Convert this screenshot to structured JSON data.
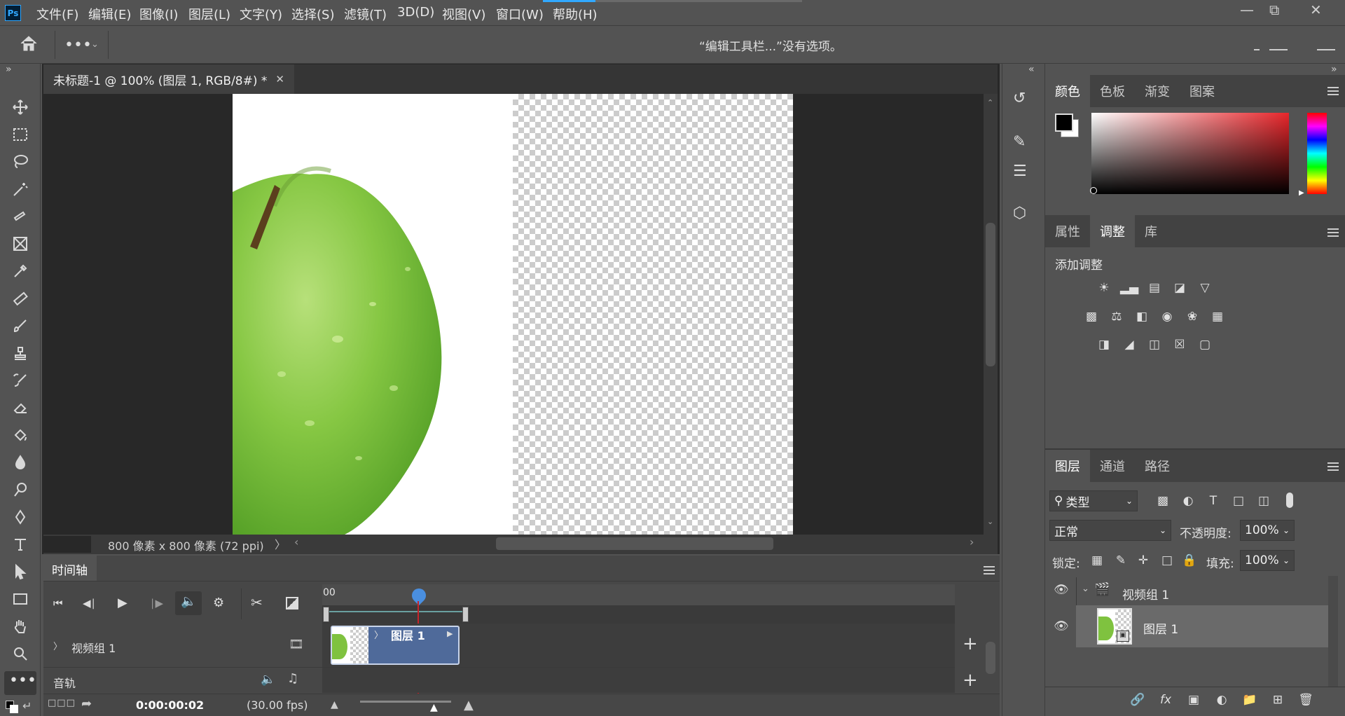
{
  "app": {
    "logo": "Ps"
  },
  "menu": [
    "文件(F)",
    "编辑(E)",
    "图像(I)",
    "图层(L)",
    "文字(Y)",
    "选择(S)",
    "滤镜(T)",
    "3D(D)",
    "视图(V)",
    "窗口(W)",
    "帮助(H)"
  ],
  "options_bar": {
    "message": "“编辑工具栏...”没有选项。"
  },
  "document": {
    "tab_title": "未标题-1 @ 100% (图层 1, RGB/8#) *",
    "status": "800 像素 x 800 像素 (72 ppi)"
  },
  "timeline": {
    "title": "时间轴",
    "ruler_start": "00",
    "track_video_group": "视频组 1",
    "track_audio": "音轨",
    "clip_label": "图层 1",
    "timecode": "0:00:00:02",
    "fps": "(30.00 fps)"
  },
  "color_panel": {
    "tabs": [
      "颜色",
      "色板",
      "渐变",
      "图案"
    ],
    "active": "颜色",
    "foreground": "#000000",
    "background": "#ffffff"
  },
  "adjust_panel": {
    "tabs": [
      "属性",
      "调整",
      "库"
    ],
    "active": "调整",
    "heading": "添加调整"
  },
  "layers_panel": {
    "tabs": [
      "图层",
      "通道",
      "路径"
    ],
    "active": "图层",
    "filter_kind": "类型",
    "blend_mode": "正常",
    "opacity_label": "不透明度:",
    "opacity_value": "100%",
    "lock_label": "锁定:",
    "fill_label": "填充:",
    "fill_value": "100%",
    "layers": [
      {
        "name": "视频组 1",
        "type": "group"
      },
      {
        "name": "图层 1",
        "type": "video-layer"
      }
    ]
  },
  "colors": {
    "ui_bg": "#535353",
    "canvas_dark": "#282828",
    "apple_green": "#7fc23f",
    "clip_blue": "#4f6a9a",
    "playhead": "#c8242a"
  }
}
